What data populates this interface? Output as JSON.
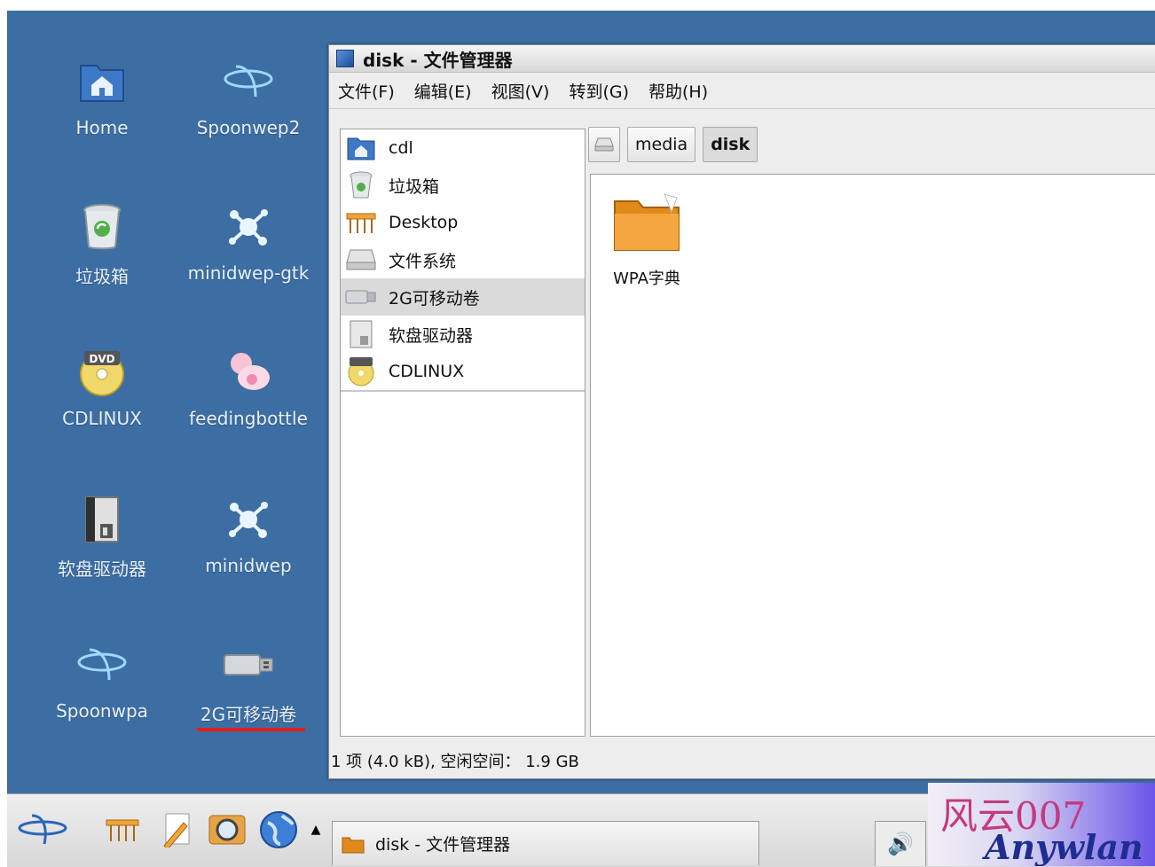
{
  "desktop": {
    "icons": [
      {
        "label": "Home",
        "icon": "home-folder-icon"
      },
      {
        "label": "Spoonwep2",
        "icon": "spoon-logo-icon"
      },
      {
        "label": "垃圾箱",
        "icon": "trash-icon"
      },
      {
        "label": "minidwep-gtk",
        "icon": "splash-icon"
      },
      {
        "label": "CDLINUX",
        "icon": "dvd-icon"
      },
      {
        "label": "feedingbottle",
        "icon": "bottle-icon"
      },
      {
        "label": "软盘驱动器",
        "icon": "floppy-icon"
      },
      {
        "label": "minidwep",
        "icon": "splash-icon"
      },
      {
        "label": "Spoonwpa",
        "icon": "spoon-logo-icon"
      },
      {
        "label": "2G可移动卷",
        "icon": "usb-drive-icon"
      }
    ]
  },
  "window": {
    "title": "disk - 文件管理器",
    "menu": [
      "文件(F)",
      "编辑(E)",
      "视图(V)",
      "转到(G)",
      "帮助(H)"
    ],
    "sidebar": [
      {
        "label": "cdl",
        "icon": "home-folder-icon"
      },
      {
        "label": "垃圾箱",
        "icon": "trash-icon"
      },
      {
        "label": "Desktop",
        "icon": "desktop-icon"
      },
      {
        "label": "文件系统",
        "icon": "harddrive-icon"
      },
      {
        "label": "2G可移动卷",
        "icon": "usb-drive-icon",
        "selected": true
      },
      {
        "label": "软盘驱动器",
        "icon": "floppy-icon"
      },
      {
        "label": "CDLINUX",
        "icon": "dvd-icon"
      }
    ],
    "breadcrumb": {
      "items": [
        "media",
        "disk"
      ],
      "active": "disk"
    },
    "files": [
      {
        "name": "WPA字典",
        "icon": "folder-icon"
      }
    ],
    "status": "1 项 (4.0 kB), 空闲空间： 1.9 GB"
  },
  "taskbar": {
    "task_title": "disk - 文件管理器",
    "launchers": [
      "logo-icon",
      "desktop-icon",
      "editor-icon",
      "search-icon",
      "browser-icon"
    ]
  },
  "watermark": {
    "cn": "风云007",
    "en": "Anywlan"
  }
}
